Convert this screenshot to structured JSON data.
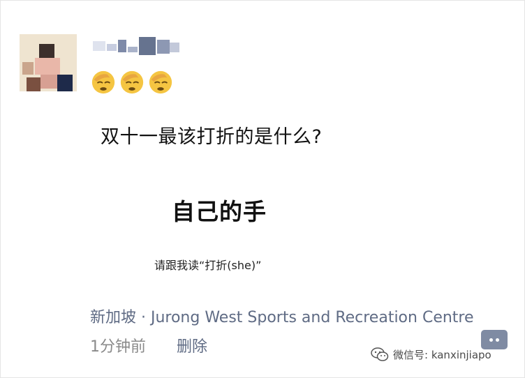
{
  "post": {
    "username": "[blurred]",
    "emojis": [
      "facepalm-icon",
      "facepalm-icon",
      "facepalm-icon"
    ],
    "question": "双十一最该打折的是什么?",
    "answer": "自己的手",
    "hint": "请跟我读“打折(she)”",
    "location": "新加坡 · Jurong West Sports and Recreation Centre",
    "time": "1分钟前",
    "delete_label": "删除"
  },
  "watermark": {
    "text": "微信号: kanxinjiapo",
    "icon": "wechat-icon"
  },
  "colors": {
    "link": "#5f6b84",
    "comment_button": "#7f8ba3",
    "muted": "#8a8a8a"
  }
}
